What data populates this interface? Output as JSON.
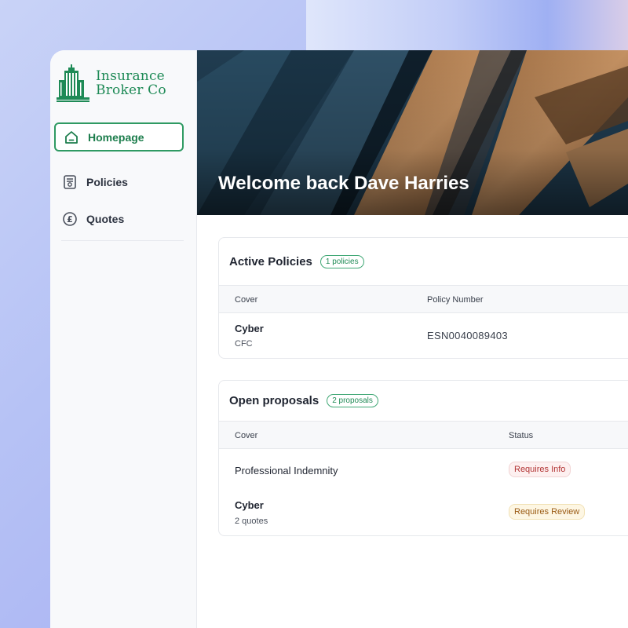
{
  "brand": {
    "line1": "Insurance",
    "line2": "Broker Co",
    "color": "#1e8a56"
  },
  "nav": {
    "items": [
      {
        "label": "Homepage",
        "icon": "home-icon",
        "active": true
      },
      {
        "label": "Policies",
        "icon": "certificate-icon",
        "active": false
      },
      {
        "label": "Quotes",
        "icon": "pound-icon",
        "active": false
      }
    ]
  },
  "hero": {
    "title": "Welcome back Dave Harries"
  },
  "active_policies": {
    "title": "Active Policies",
    "badge": "1 policies",
    "columns": [
      "Cover",
      "Policy Number"
    ],
    "rows": [
      {
        "cover": "Cyber",
        "provider": "CFC",
        "policy_number": "ESN0040089403"
      }
    ]
  },
  "open_proposals": {
    "title": "Open proposals",
    "badge": "2 proposals",
    "columns": [
      "Cover",
      "Status"
    ],
    "rows": [
      {
        "cover": "Professional Indemnity",
        "sub": "",
        "status": "Requires Info",
        "status_color": "#b23434"
      },
      {
        "cover": "Cyber",
        "sub": "2 quotes",
        "status": "Requires Review",
        "status_color": "#9a5a13"
      }
    ]
  },
  "colors": {
    "accent": "#2f9a63",
    "sidebar_bg": "#f8f9fb"
  }
}
